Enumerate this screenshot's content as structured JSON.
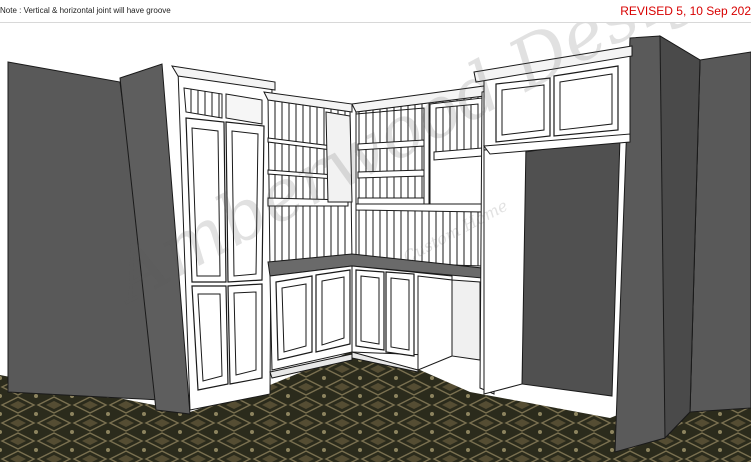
{
  "note": "Note : Vertical & horizontal joint will have groove",
  "revised": "REVISED 5, 10 Sep 202",
  "watermark": {
    "main": "Amberwood Designs",
    "sub": "Custom Home"
  },
  "colors": {
    "wall": "#595959",
    "wall_dark": "#4a4a4a",
    "cabinet": "#ffffff",
    "outline": "#1a1a1a",
    "floor": "#2b2b1c",
    "floor_pattern": "#7a7050",
    "revised_text": "#d80000"
  }
}
